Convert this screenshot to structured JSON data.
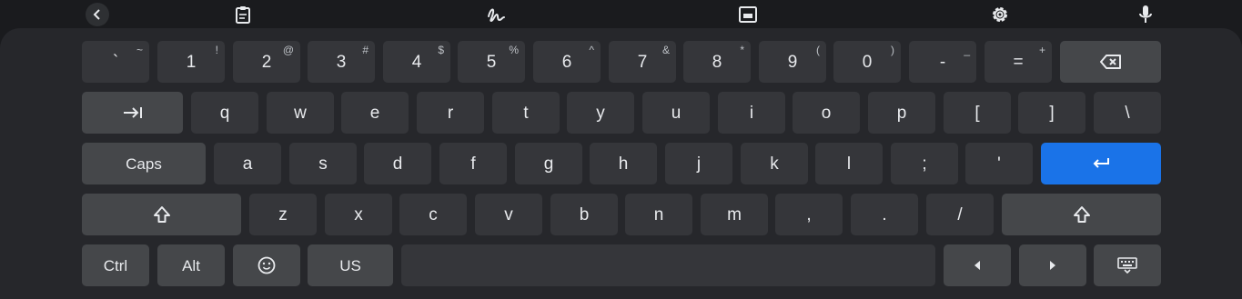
{
  "toolbar": {
    "icons": [
      "back-icon",
      "clipboard-icon",
      "handwriting-icon",
      "floating-mode-icon",
      "settings-icon",
      "microphone-icon"
    ]
  },
  "keyboard": {
    "row1": [
      {
        "main": "`",
        "sub": "~"
      },
      {
        "main": "1",
        "sub": "!"
      },
      {
        "main": "2",
        "sub": "@"
      },
      {
        "main": "3",
        "sub": "#"
      },
      {
        "main": "4",
        "sub": "$"
      },
      {
        "main": "5",
        "sub": "%"
      },
      {
        "main": "6",
        "sub": "^"
      },
      {
        "main": "7",
        "sub": "&"
      },
      {
        "main": "8",
        "sub": "*"
      },
      {
        "main": "9",
        "sub": "("
      },
      {
        "main": "0",
        "sub": ")"
      },
      {
        "main": "-",
        "sub": "_"
      },
      {
        "main": "=",
        "sub": "+"
      }
    ],
    "row2": [
      "q",
      "w",
      "e",
      "r",
      "t",
      "y",
      "u",
      "i",
      "o",
      "p",
      "[",
      "]",
      "\\"
    ],
    "row3": [
      "a",
      "s",
      "d",
      "f",
      "g",
      "h",
      "j",
      "k",
      "l",
      ";",
      "'"
    ],
    "row4": [
      "z",
      "x",
      "c",
      "v",
      "b",
      "n",
      "m",
      ",",
      ".",
      "/"
    ],
    "caps_label": "Caps",
    "ctrl_label": "Ctrl",
    "alt_label": "Alt",
    "layout_label": "US",
    "colors": {
      "enter": "#1a73e8",
      "key": "#35363a",
      "modifier": "#45474a",
      "panel": "#26272b"
    }
  }
}
